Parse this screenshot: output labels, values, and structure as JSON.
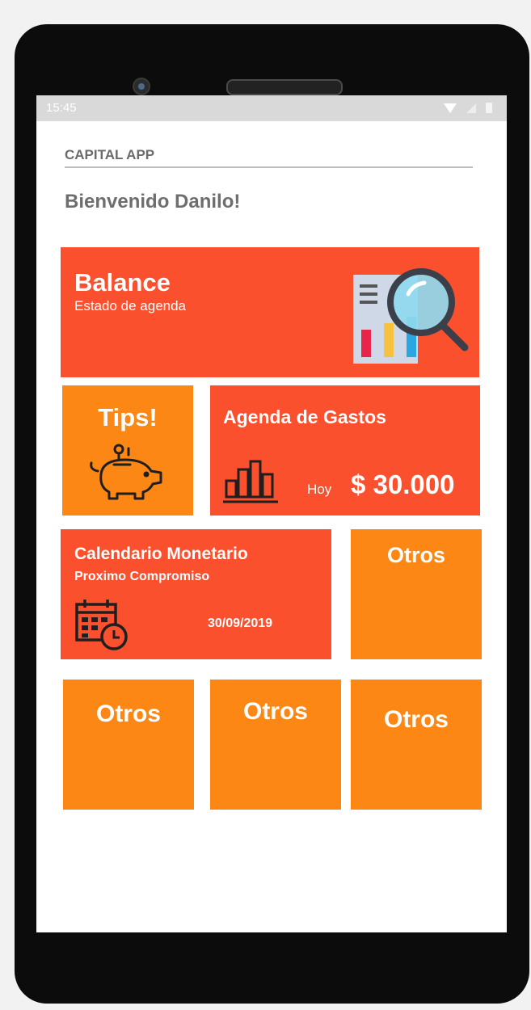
{
  "status_bar": {
    "time": "15:45",
    "icons": [
      "wifi-icon",
      "signal-icon",
      "battery-icon"
    ]
  },
  "header": {
    "app_title": "CAPITAL APP",
    "welcome": "Bienvenido Danilo!"
  },
  "tiles": {
    "balance": {
      "title": "Balance",
      "subtitle": "Estado de agenda",
      "icon": "report-magnifier-icon",
      "color": "#fa502d"
    },
    "tips": {
      "title": "Tips!",
      "icon": "piggy-bank-icon",
      "color": "#fd8714"
    },
    "gastos": {
      "title": "Agenda de Gastos",
      "hoy_label": "Hoy",
      "amount": "$ 30.000",
      "icon": "bar-chart-icon",
      "color": "#fa502d"
    },
    "calendario": {
      "title": "Calendario Monetario",
      "subtitle": "Proximo Compromiso",
      "date": "30/09/2019",
      "icon": "calendar-clock-icon",
      "color": "#fa502d"
    },
    "otros": [
      "Otros",
      "Otros",
      "Otros",
      "Otros"
    ]
  },
  "colors": {
    "red": "#fa502d",
    "orange": "#fd8714",
    "title_gray": "#6b6b6b"
  }
}
